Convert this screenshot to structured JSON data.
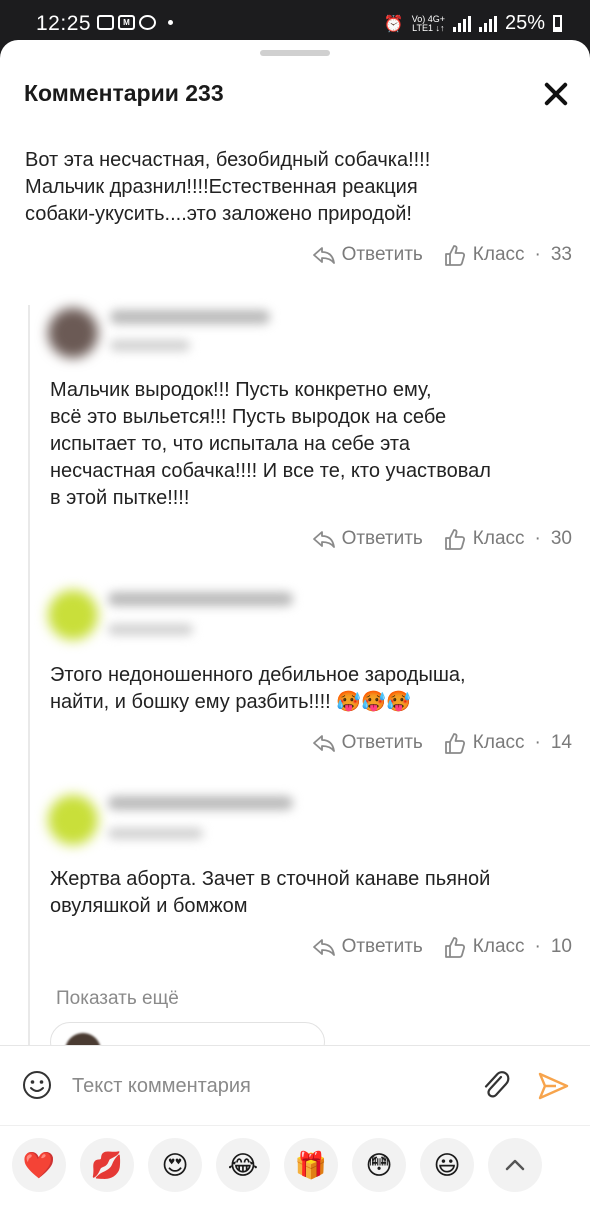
{
  "status_bar": {
    "time": "12:25",
    "network_top": "Vo) 4G+",
    "network_bottom": "LTE1 ↓↑",
    "battery": "25%"
  },
  "header": {
    "title": "Комментарии 233"
  },
  "comments": [
    {
      "text": "Вот эта несчастная, безобидный собачка!!!!\nМальчик дразнил!!!!Естественная реакция\nсобаки-укусить....это заложено природой!",
      "reply_label": "Ответить",
      "like_label": "Класс",
      "likes": "33"
    },
    {
      "text": "Мальчик выродок!!! Пусть конкретно ему,\nвсё это выльется!!! Пусть выродок на себе\nиспытает то, что испытала на себе эта\nнесчастная собачка!!!! И все те, кто участвовал\nв этой пытке!!!!",
      "reply_label": "Ответить",
      "like_label": "Класс",
      "likes": "30"
    },
    {
      "text": "Этого недоношенного дебильное зародыша,\nнайти, и бошку ему разбить!!!! 🥵🥵🥵",
      "reply_label": "Ответить",
      "like_label": "Класс",
      "likes": "14"
    },
    {
      "text": "Жертва аборта. Зачет в сточной канаве пьяной\nовуляшкой и бомжом",
      "reply_label": "Ответить",
      "like_label": "Класс",
      "likes": "10"
    }
  ],
  "show_more": "Показать ещё",
  "input": {
    "placeholder": "Текст комментария"
  },
  "reactions": [
    "❤️",
    "💋",
    "😍",
    "😂",
    "🎁",
    "😳",
    "😃"
  ],
  "colors": {
    "accent": "#f7a44c",
    "muted": "#7a7a7a"
  },
  "icons": [
    "smile-icon",
    "paperclip-icon",
    "send-icon",
    "chevron-up-icon",
    "reply-icon",
    "thumbs-up-icon",
    "close-icon"
  ]
}
